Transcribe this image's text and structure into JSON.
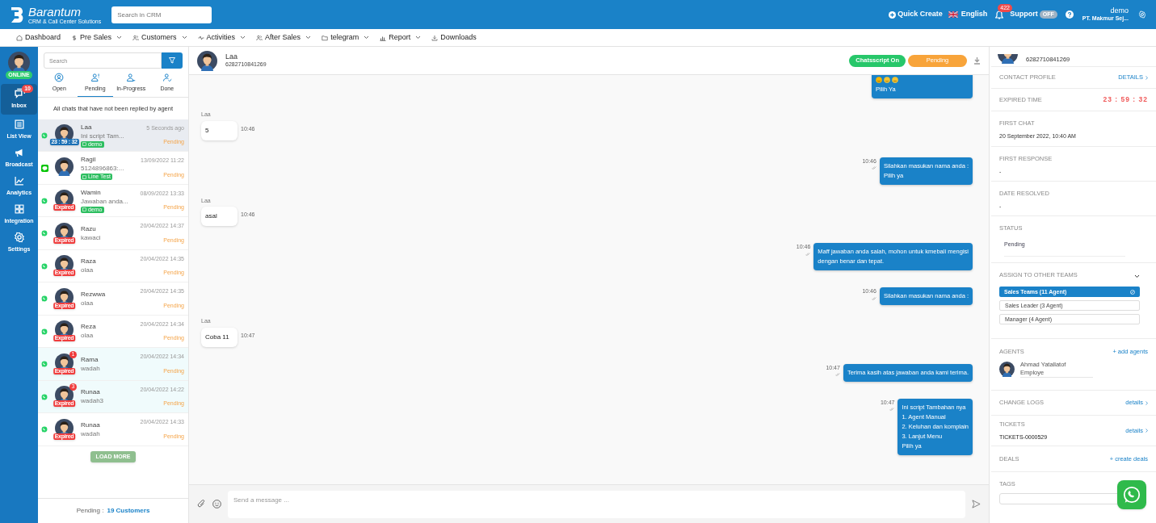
{
  "topbar": {
    "brand": "Barantum",
    "tagline": "CRM & Call Center Solutions",
    "search_placeholder": "Search in CRM",
    "quick_create": "Quick Create",
    "language": "English",
    "notifications": "422",
    "support": "Support",
    "support_toggle": "OFF",
    "user": "demo",
    "company": "PT. Makmur Sej..."
  },
  "nav": [
    {
      "label": "Dashboard",
      "dropdown": false
    },
    {
      "label": "Pre Sales",
      "dropdown": true
    },
    {
      "label": "Customers",
      "dropdown": true
    },
    {
      "label": "Activities",
      "dropdown": true
    },
    {
      "label": "After Sales",
      "dropdown": true
    },
    {
      "label": "telegram",
      "dropdown": true
    },
    {
      "label": "Report",
      "dropdown": true
    },
    {
      "label": "Downloads",
      "dropdown": false
    }
  ],
  "rail": {
    "status": "ONLINE",
    "items": [
      {
        "label": "Inbox",
        "selected": true,
        "badge": "10"
      },
      {
        "label": "List View",
        "selected": false
      },
      {
        "label": "Broadcast",
        "selected": false
      },
      {
        "label": "Analytics",
        "selected": false
      },
      {
        "label": "Integration",
        "selected": false
      },
      {
        "label": "Settings",
        "selected": false
      }
    ]
  },
  "chat_list": {
    "search_placeholder": "Search",
    "tabs": [
      {
        "label": "Open",
        "selected": false
      },
      {
        "label": "Pending",
        "selected": true
      },
      {
        "label": "In-Progress",
        "selected": false
      },
      {
        "label": "Done",
        "selected": false
      }
    ],
    "description": "All chats that have not been replied by agent",
    "items": [
      {
        "kind": "whatsapp",
        "name": "Laa",
        "preview": "Ini script Tam...",
        "time": "5 Seconds ago",
        "status": "Pending",
        "timer": "23 : 59 : 32",
        "expired": false,
        "tag": "demo",
        "selected": true,
        "unread": false
      },
      {
        "kind": "line",
        "name": "Ragil",
        "preview": "5124896863:...",
        "time": "13/09/2022 11:22",
        "status": "Pending",
        "tag": "Line Test",
        "selected": false,
        "unread": false
      },
      {
        "kind": "whatsapp",
        "name": "Wamin",
        "preview": "Jawaban anda...",
        "time": "08/09/2022 13:33",
        "status": "Pending",
        "timer": "Expired",
        "expired": true,
        "tag": "demo",
        "selected": false,
        "unread": false
      },
      {
        "kind": "whatsapp",
        "name": "Razu",
        "preview": "kawaci",
        "time": "20/04/2022 14:37",
        "status": "Pending",
        "timer": "Expired",
        "expired": true,
        "selected": false,
        "unread": false
      },
      {
        "kind": "whatsapp",
        "name": "Raza",
        "preview": "olaa",
        "time": "20/04/2022 14:35",
        "status": "Pending",
        "timer": "Expired",
        "expired": true,
        "selected": false,
        "unread": false
      },
      {
        "kind": "whatsapp",
        "name": "Rezwwa",
        "preview": "olaa",
        "time": "20/04/2022 14:35",
        "status": "Pending",
        "timer": "Expired",
        "expired": true,
        "selected": false,
        "unread": false
      },
      {
        "kind": "whatsapp",
        "name": "Reza",
        "preview": "olaa",
        "time": "20/04/2022 14:34",
        "status": "Pending",
        "timer": "Expired",
        "expired": true,
        "selected": false,
        "unread": false
      },
      {
        "kind": "whatsapp",
        "name": "Rama",
        "preview": "wadah",
        "time": "20/04/2022 14:34",
        "status": "Pending",
        "timer": "Expired",
        "expired": true,
        "selected": false,
        "unread": true,
        "unread_count": "1"
      },
      {
        "kind": "whatsapp",
        "name": "Runaa",
        "preview": "wadah3",
        "time": "20/04/2022 14:22",
        "status": "Pending",
        "timer": "Expired",
        "expired": true,
        "selected": false,
        "unread": true,
        "unread_count": "3"
      },
      {
        "kind": "whatsapp",
        "name": "Runaa",
        "preview": "wadah",
        "time": "20/04/2022 14:33",
        "status": "Pending",
        "timer": "Expired",
        "expired": true,
        "selected": false,
        "unread": false
      }
    ],
    "load_more": "LOAD MORE",
    "footer_label": "Pending :",
    "footer_count": "19 Customers"
  },
  "conversation": {
    "name": "Laa",
    "phone": "6282710841269",
    "chatscript": "Chatsscript On",
    "status": "Pending",
    "input_placeholder": "Send a message ...",
    "messages": [
      {
        "kind": "out",
        "text": "Pilih Ya",
        "emoji": true,
        "cut": true
      },
      {
        "kind": "in",
        "sender": "Laa",
        "text": "5",
        "time": "10:46"
      },
      {
        "kind": "out",
        "text": "Silahkan masukan nama anda :\nPilih ya",
        "time": "10:46"
      },
      {
        "kind": "in",
        "sender": "Laa",
        "text": "asal",
        "time": "10:46"
      },
      {
        "kind": "out",
        "text": "Maff jawaban anda salah, mohon untuk kmebali mengisi\ndengan benar dan tepat.",
        "time": "10:46"
      },
      {
        "kind": "out",
        "text": "Silahkan masukan nama anda :",
        "time": "10:46"
      },
      {
        "kind": "in",
        "sender": "Laa",
        "text": "Coba 11",
        "time": "10:47"
      },
      {
        "kind": "out",
        "text": "Terima kasih atas jawaban anda kami terima.",
        "time": "10:47"
      },
      {
        "kind": "out",
        "text": "Ini script Tambahan nya\n1. Agent Manual\n2. Keluhan dan komplain\n3. Lanjut Menu\nPilih ya",
        "time": "10:47"
      }
    ]
  },
  "contact_panel": {
    "phone": "6282710841269",
    "contact_profile": {
      "label": "CONTACT PROFILE",
      "link": "DETAILS"
    },
    "expired_time": {
      "label": "EXPIRED TIME",
      "value": "23 : 59 : 32"
    },
    "first_chat": {
      "label": "FIRST CHAT",
      "value": "20 September 2022, 10:40 AM"
    },
    "first_response": {
      "label": "FIRST RESPONSE",
      "value": "-"
    },
    "date_resolved": {
      "label": "DATE RESOLVED",
      "value": "-"
    },
    "status": {
      "label": "STATUS",
      "value": "Pending"
    },
    "teams": {
      "label": "ASSIGN TO OTHER TEAMS",
      "items": [
        {
          "name": "Sales Teams (11 Agent)",
          "selected": true
        },
        {
          "name": "Sales Leader (3 Agent)",
          "selected": false
        },
        {
          "name": "Manager (4 Agent)",
          "selected": false
        }
      ]
    },
    "agents": {
      "label": "AGENTS",
      "link": "+ add agents",
      "items": [
        {
          "name": "Ahmad Yatallatof",
          "role": "Employe"
        }
      ]
    },
    "change_logs": {
      "label": "CHANGE LOGS",
      "link": "details"
    },
    "tickets": {
      "label": "TICKETS",
      "value": "TICKETS-0000529",
      "link": "details"
    },
    "deals": {
      "label": "DEALS",
      "link": "+ create deals"
    },
    "tags": {
      "label": "TAGS"
    }
  }
}
